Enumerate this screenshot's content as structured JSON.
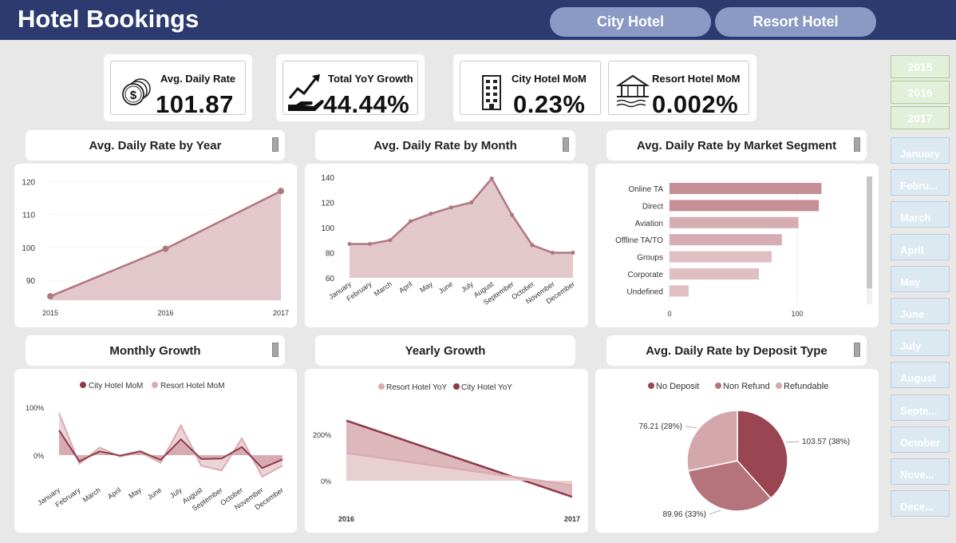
{
  "header": {
    "title": "Hotel Bookings",
    "buttons": [
      "City Hotel",
      "Resort Hotel"
    ]
  },
  "kpis": {
    "adr": {
      "label": "Avg. Daily Rate",
      "value": "101.87",
      "icon": "dollar-coins-icon"
    },
    "yoy": {
      "label": "Total YoY Growth",
      "value": "44.44%",
      "icon": "growth-hand-icon"
    },
    "city_mom": {
      "label": "City Hotel MoM",
      "value": "0.23%",
      "icon": "building-icon"
    },
    "resort_mom": {
      "label": "Resort Hotel MoM",
      "value": "0.002%",
      "icon": "resort-icon"
    }
  },
  "chart_titles": {
    "year": "Avg. Daily Rate by Year",
    "month": "Avg. Daily Rate by Month",
    "segment": "Avg. Daily Rate by Market Segment",
    "monthly_growth": "Monthly Growth",
    "yearly_growth": "Yearly Growth",
    "deposit": "Avg. Daily Rate by Deposit Type"
  },
  "slicers": {
    "years": [
      "2015",
      "2016",
      "2017"
    ],
    "months": [
      "January",
      "Febru...",
      "March",
      "April",
      "May",
      "June",
      "July",
      "August",
      "Septe...",
      "October",
      "Nove...",
      "Dece..."
    ]
  },
  "colors": {
    "header": "#2c3a6f",
    "area_fill": "#e2c7cb",
    "area_line": "#b0777e",
    "dark_series": "#8e3b48",
    "light_series": "#d9acb1",
    "deposit_colors": [
      "#9a4652",
      "#b5747c",
      "#d4a7ac"
    ]
  },
  "chart_data": [
    {
      "id": "adr_by_year",
      "type": "area",
      "categories": [
        "2015",
        "2016",
        "2017"
      ],
      "values": [
        85.2,
        99.6,
        117.1
      ],
      "yticks": [
        "90",
        "100",
        "110",
        "120"
      ],
      "ylim": [
        84,
        122
      ]
    },
    {
      "id": "adr_by_month",
      "type": "area",
      "categories": [
        "January",
        "February",
        "March",
        "April",
        "May",
        "June",
        "July",
        "August",
        "September",
        "October",
        "November",
        "December"
      ],
      "values": [
        87,
        87,
        90,
        105,
        111,
        116,
        120,
        139,
        110,
        86,
        80,
        80
      ],
      "yticks": [
        "60",
        "80",
        "100",
        "120",
        "140"
      ],
      "ylim": [
        60,
        140
      ]
    },
    {
      "id": "adr_by_segment",
      "type": "bar",
      "categories": [
        "Online TA",
        "Direct",
        "Aviation",
        "Offline TA/TO",
        "Groups",
        "Corporate",
        "Undefined"
      ],
      "values": [
        119,
        117,
        101,
        88,
        80,
        70,
        15
      ],
      "xticks": [
        "0",
        "100"
      ],
      "xlim": [
        0,
        150
      ]
    },
    {
      "id": "monthly_growth",
      "type": "area",
      "categories": [
        "January",
        "February",
        "March",
        "April",
        "May",
        "June",
        "July",
        "August",
        "September",
        "October",
        "November",
        "December"
      ],
      "series": [
        {
          "name": "City Hotel MoM",
          "values": [
            52,
            -13,
            8,
            -1,
            8,
            -10,
            33,
            -8,
            -7,
            17,
            -27,
            -9
          ]
        },
        {
          "name": "Resort Hotel MoM",
          "values": [
            88,
            -18,
            16,
            -3,
            6,
            -16,
            62,
            -22,
            -32,
            35,
            -45,
            -22
          ]
        }
      ],
      "yticks": [
        "0%",
        "100%"
      ],
      "ylim": [
        -60,
        110
      ]
    },
    {
      "id": "yearly_growth",
      "type": "area",
      "categories": [
        "2016",
        "2017"
      ],
      "series": [
        {
          "name": "Resort Hotel YoY",
          "values": [
            120,
            -20
          ]
        },
        {
          "name": "City Hotel YoY",
          "values": [
            260,
            -70
          ]
        }
      ],
      "yticks": [
        "0%",
        "200%"
      ],
      "ylim": [
        -90,
        290
      ]
    },
    {
      "id": "adr_by_deposit",
      "type": "pie",
      "categories": [
        "No Deposit",
        "Non Refund",
        "Refundable"
      ],
      "values": [
        103.57,
        89.96,
        76.21
      ],
      "labels": [
        "103.57 (38%)",
        "89.96 (33%)",
        "76.21 (28%)"
      ]
    }
  ]
}
